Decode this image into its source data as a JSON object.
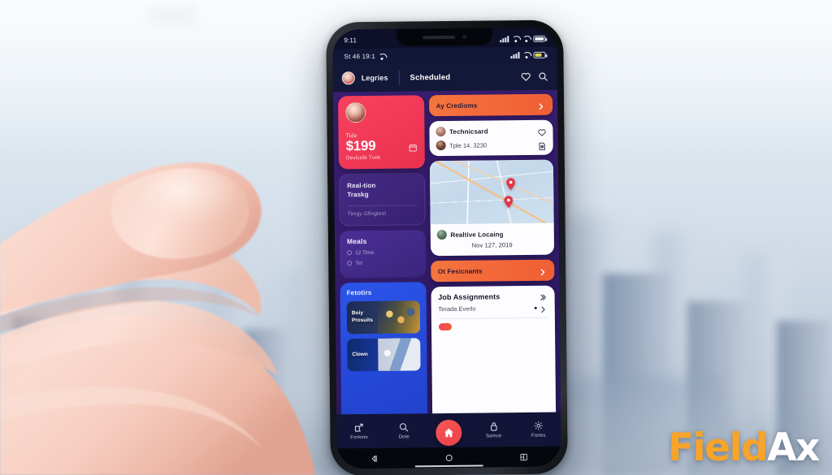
{
  "background": {
    "scene": "blurred-city-skyline",
    "description": "Out-of-focus high-rise city skyline seen from above"
  },
  "brand": {
    "logo_part1": "Field",
    "logo_part2": "Ax",
    "color_primary": "#f7a428",
    "color_secondary": "#ffffff"
  },
  "phone": {
    "status_bar_top": {
      "time": "9:11",
      "signal_icon": "signal-bars-icon",
      "wifi_icon": "wifi-icon",
      "wifi_icon_2": "wifi-icon",
      "battery_icon": "battery-icon"
    },
    "status_bar_app": {
      "label": "St 46 19:1",
      "wifi_icon": "wifi-icon",
      "signal_icon": "signal-bars-icon",
      "battery_icon": "battery-icon"
    },
    "header": {
      "avatar": "user-avatar",
      "user_label": "Legries",
      "tab_label": "Scheduled",
      "favorite_icon": "heart-icon",
      "search_icon": "search-icon"
    },
    "left_column": {
      "price_card": {
        "avatar": "technician-avatar",
        "label": "Tide",
        "price": "$199",
        "subtitle": "Devicefe Tvek",
        "badge_icon": "calendar-icon"
      },
      "tracking_card": {
        "title_line1": "Real-tion",
        "title_line2": "Traskg",
        "subtitle": "Timgy Gfingteol"
      },
      "media_card": {
        "title": "Meals",
        "row1": "12 Time",
        "row2": "Tirl"
      },
      "features_card": {
        "title": "Fetotirs",
        "thumb1_caption_line1": "Boiy",
        "thumb1_caption_line2": "Prosuits",
        "thumb2_caption": "Clown"
      }
    },
    "right_column": {
      "primary_button": {
        "label": "Ay Credioms",
        "chevron_icon": "chevron-right-icon"
      },
      "technician_card": {
        "title": "Technicsard",
        "subtitle": "Tple 14. 3230",
        "favorite_icon": "heart-icon",
        "note_icon": "note-clock-icon"
      },
      "map_card": {
        "map_label": "map-view",
        "pin1": "map-pin-icon",
        "pin2": "map-pin-icon",
        "avatar": "location-avatar",
        "title": "Realtive Locaing",
        "date": "Nov 127, 2019"
      },
      "secondary_button": {
        "label": "Ot Fesicnants",
        "chevron_icon": "chevron-right-icon"
      },
      "job_card": {
        "title": "Job Assignments",
        "title_icon": "double-chevron-right-icon",
        "subtitle": "Terada Everlo",
        "subtitle_icon": "dot-chevron-right-icon"
      }
    },
    "tab_bar": {
      "items": [
        {
          "label": "Fortorio",
          "icon": "share-box-icon"
        },
        {
          "label": "Dote",
          "icon": "search-icon"
        },
        {
          "label": "",
          "icon": "home-icon"
        },
        {
          "label": "Samce",
          "icon": "lock-icon"
        },
        {
          "label": "Fortes",
          "icon": "settings-gear-icon"
        }
      ]
    },
    "android_nav": {
      "back_icon": "back-triangle-icon",
      "home_icon": "home-circle-icon",
      "recents_icon": "recents-square-icon"
    }
  }
}
